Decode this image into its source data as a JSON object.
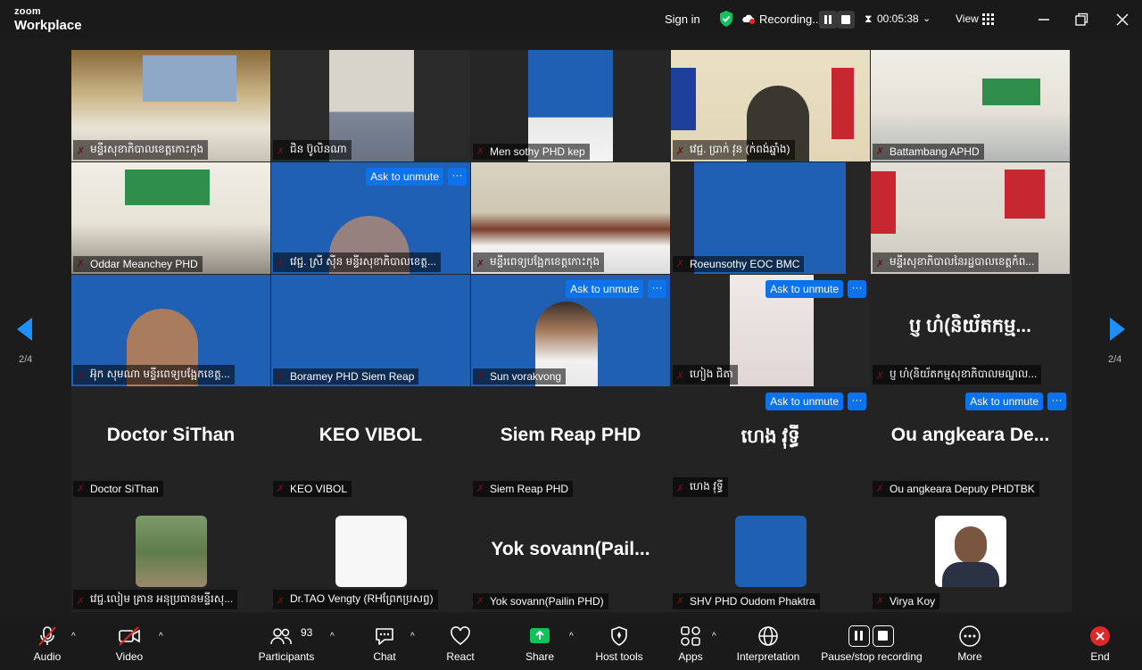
{
  "app": {
    "brand_top": "zoom",
    "brand_bottom": "Workplace"
  },
  "topbar": {
    "sign_in": "Sign in",
    "recording": "Recording...",
    "timer": "00:05:38",
    "view": "View"
  },
  "pager": {
    "left": "2/4",
    "right": "2/4"
  },
  "tile_actions": {
    "ask_to_unmute": "Ask to unmute",
    "more": "···"
  },
  "tiles": [
    {
      "name": "មន្ទីរសុខាភិបាលខេត្តកោះកុង"
    },
    {
      "name": "ជិន ប៊ូលិនណា"
    },
    {
      "name": "Men sothy PHD kep"
    },
    {
      "name": "វេជ្ជ. ប្រាក់ វុន (ក់ពង់ឆ្នាំង)"
    },
    {
      "name": "Battambang APHD"
    },
    {
      "name": "Oddar Meanchey PHD"
    },
    {
      "name": "វេជ្ជ. ស្រី ស៊ីន មន្ទីរសុខាភិបាលខេត្ត..."
    },
    {
      "name": "មន្ទីរពេទ្យបង្អែកខេត្តកោះកុង"
    },
    {
      "name": "Roeunsothy EOC BMC"
    },
    {
      "name": "មន្ទីរសុខាភិបាលនៃរដ្ឋបាលខេត្តកំព..."
    },
    {
      "name": "អ៊ុក សុមណា មន្ទីរពេទ្យបង្អែកខេត្ត..."
    },
    {
      "name": "Boramey PHD Siem Reap"
    },
    {
      "name": "Sun vorakvong"
    },
    {
      "name": "ហៀង ជិតា"
    },
    {
      "name": "ប្ញ ហ៎(និយ័តកម្មសុខាភិបាលមណ្ឌល...",
      "big": "ប្ញ ហ៎(និយ័តកម្ម..."
    },
    {
      "name": "Doctor SiThan",
      "big": "Doctor SiThan"
    },
    {
      "name": "KEO VIBOL",
      "big": "KEO VIBOL"
    },
    {
      "name": "Siem Reap PHD",
      "big": "Siem Reap PHD"
    },
    {
      "name": "ហេង វុទ្ធី",
      "big": "ហេង វុទ្ធី"
    },
    {
      "name": "Ou angkeara Deputy PHDTBK",
      "big": "Ou angkeara De..."
    },
    {
      "name": "វេជ្ជ.លៀម គ្រាន អនុប្រធានមន្ទីរសុ..."
    },
    {
      "name": "Dr.TAO Vengty (RHព្រែកប្រសព្វ)"
    },
    {
      "name": "Yok sovann(Pailin PHD)",
      "big": "Yok  sovann(Pail..."
    },
    {
      "name": "SHV PHD Oudom Phaktra"
    },
    {
      "name": "Virya Koy"
    }
  ],
  "toolbar": {
    "audio": "Audio",
    "video": "Video",
    "participants": "Participants",
    "participants_count": "93",
    "chat": "Chat",
    "react": "React",
    "share": "Share",
    "host_tools": "Host tools",
    "apps": "Apps",
    "interpretation": "Interpretation",
    "pause_stop": "Pause/stop recording",
    "more": "More",
    "end": "End"
  },
  "colors": {
    "accent": "#0e72ed",
    "share": "#10c25a",
    "end": "#e02828",
    "background": "#1c1c1c"
  }
}
